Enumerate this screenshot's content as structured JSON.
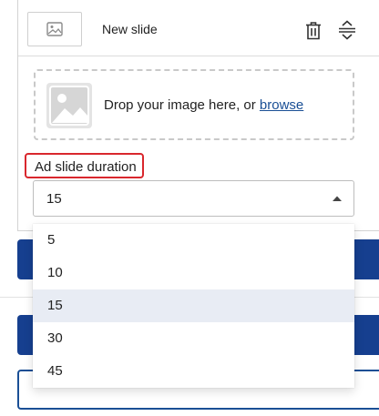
{
  "slide": {
    "name": "New slide",
    "icons": {
      "thumbnail": "image-icon",
      "delete": "trash-icon",
      "reorder": "reorder-icon"
    }
  },
  "dropzone": {
    "prompt": "Drop your image here, or ",
    "browse_label": "browse",
    "icon": "image-placeholder-icon"
  },
  "duration_field": {
    "label": "Ad slide duration",
    "selected_value": "15",
    "options": [
      "5",
      "10",
      "15",
      "30",
      "45"
    ],
    "selected_index": 2
  },
  "colors": {
    "accent": "#163f8f",
    "link": "#1a4f95",
    "highlight_border": "#d9272d",
    "selected_row": "#e8ecf4"
  }
}
